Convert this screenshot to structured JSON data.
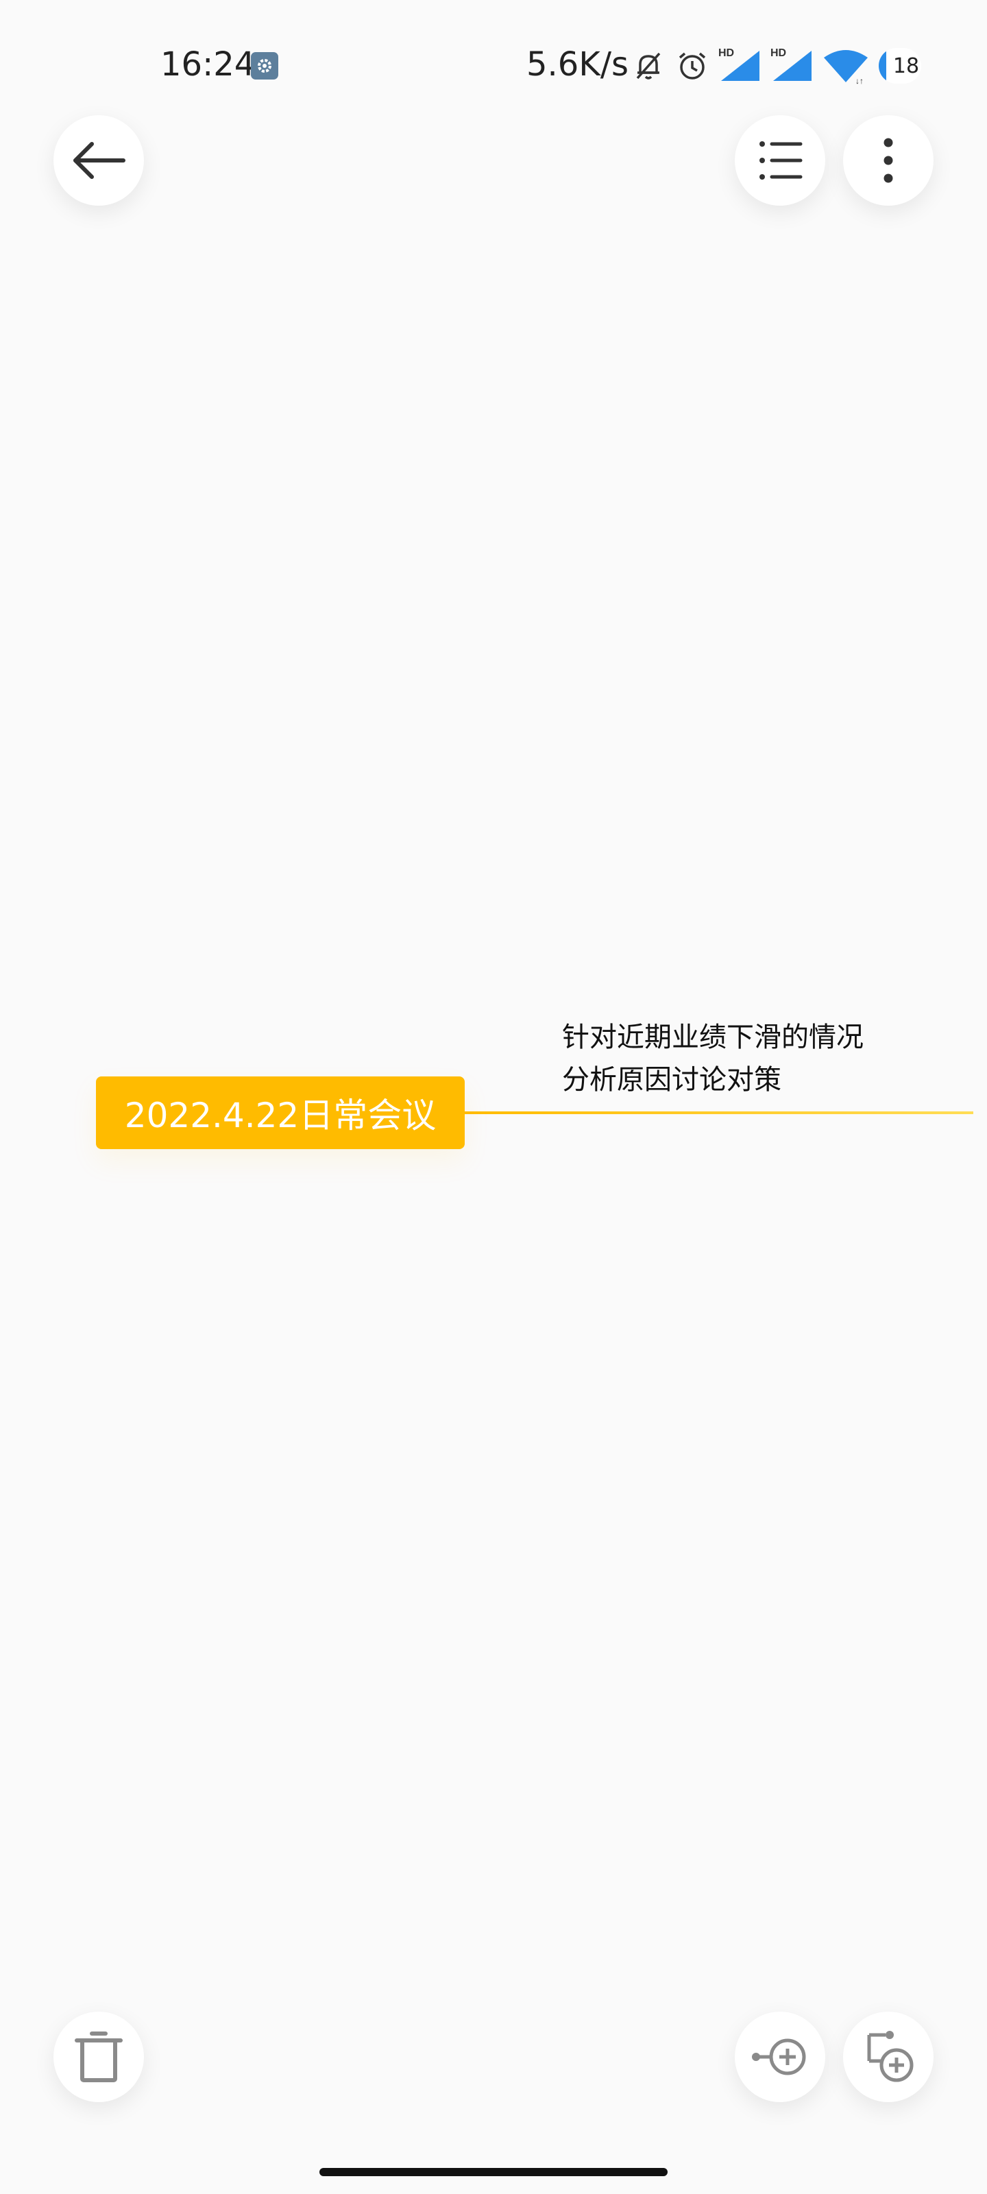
{
  "status_bar": {
    "time": "16:24",
    "network_speed": "5.6K/s",
    "battery": "18",
    "battery_level": 0.18,
    "icons": [
      "settings-icon",
      "mute-bell-icon",
      "alarm-icon",
      "hd-signal-icon",
      "hd-signal-icon",
      "wifi-icon",
      "battery-icon"
    ]
  },
  "toolbar": {
    "back_icon": "arrow-left-icon",
    "outline_icon": "list-icon",
    "more_icon": "more-vertical-icon"
  },
  "mindmap": {
    "root_label": "2022.4.22日常会议",
    "root_color": "#ffbb00",
    "child_line1": "针对近期业绩下滑的情况",
    "child_line2": "分析原因讨论对策"
  },
  "bottom_toolbar": {
    "delete_icon": "trash-icon",
    "add_child_icon": "add-child-node-icon",
    "add_sibling_icon": "add-sibling-node-icon"
  },
  "colors": {
    "accent": "#ffbb00",
    "background": "#fafafa",
    "signal_blue": "#2a8ce8"
  }
}
